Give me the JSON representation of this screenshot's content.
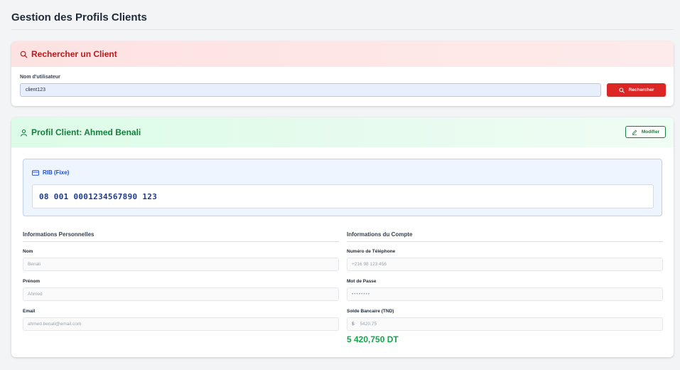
{
  "page": {
    "title": "Gestion des Profils Clients"
  },
  "search": {
    "header": "Rechercher un Client",
    "username_label": "Nom d'utilisateur",
    "username_value": "client123",
    "button_label": "Rechercher"
  },
  "profile": {
    "header": "Profil Client: Ahmed Benali",
    "modify_label": "Modifier",
    "rib": {
      "title": "RIB (Fixe)",
      "value": "08 001 0001234567890 123"
    },
    "personal": {
      "title": "Informations Personnelles",
      "nom_label": "Nom",
      "nom_value": "Benali",
      "prenom_label": "Prénom",
      "prenom_value": "Ahmed",
      "email_label": "Email",
      "email_value": "ahmed.benali@email.com"
    },
    "account": {
      "title": "Informations du Compte",
      "phone_label": "Numéro de Téléphone",
      "phone_value": "+216 98 123 456",
      "password_label": "Mot de Passe",
      "password_value": "••••••••",
      "balance_label": "Solde Bancaire (TND)",
      "balance_currency_symbol": "$",
      "balance_input": "5420.75",
      "balance_display": "5 420,750 DT"
    }
  },
  "colors": {
    "search_accent": "#dc2626",
    "profile_accent": "#15803d",
    "rib_accent": "#1d4ed8",
    "balance": "#16a34a"
  },
  "icons": {
    "search": "search-icon",
    "user": "user-icon",
    "edit": "pencil-icon",
    "card": "credit-card-icon"
  }
}
